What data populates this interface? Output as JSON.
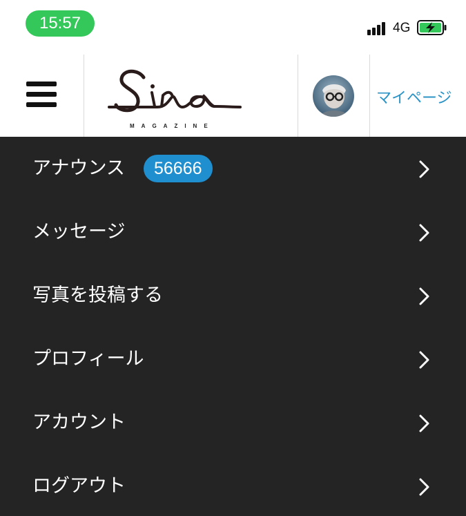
{
  "status_bar": {
    "time": "15:57",
    "network": "4G",
    "colors": {
      "time_pill": "#34c759",
      "battery_fill": "#34c759"
    }
  },
  "header": {
    "logo_text": "Sina",
    "logo_subtext": "MAGAZINE",
    "mypage_label": "マイページ",
    "colors": {
      "mypage_link": "#2b93c6"
    }
  },
  "menu": {
    "background": "#242424",
    "items": [
      {
        "label": "アナウンス",
        "badge": "56666",
        "icon": "chevron-right-icon"
      },
      {
        "label": "メッセージ",
        "icon": "chevron-right-icon"
      },
      {
        "label": "写真を投稿する",
        "icon": "chevron-right-icon"
      },
      {
        "label": "プロフィール",
        "icon": "chevron-right-icon"
      },
      {
        "label": "アカウント",
        "icon": "chevron-right-icon"
      },
      {
        "label": "ログアウト",
        "icon": "chevron-right-icon"
      }
    ],
    "badge_color": "#1f8fd0"
  }
}
